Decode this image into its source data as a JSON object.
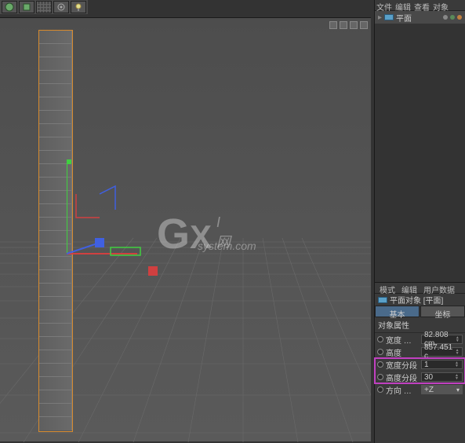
{
  "toolbar": {
    "icons": [
      "sphere-icon",
      "cube-icon",
      "grid-icon",
      "gear-icon",
      "light-icon"
    ]
  },
  "top_menu": {
    "items": [
      "文件",
      "编辑",
      "查看",
      "对象"
    ]
  },
  "hierarchy": {
    "item": {
      "label": "平面"
    }
  },
  "attr_menu": {
    "items": [
      "模式",
      "编辑",
      "用户数据"
    ]
  },
  "attributes": {
    "title": "平面对象 [平面]",
    "tabs": {
      "basic": "基本",
      "coord": "坐标"
    },
    "section": "对象属性",
    "rows": {
      "width": {
        "label": "宽度 …",
        "value": "82.808 cm"
      },
      "height": {
        "label": "高度",
        "value": "857.451 c"
      },
      "wseg": {
        "label": "宽度分段",
        "value": "1"
      },
      "hseg": {
        "label": "高度分段",
        "value": "30"
      },
      "dir": {
        "label": "方向 …",
        "value": "+Z"
      }
    }
  },
  "watermark": {
    "g": "G",
    "x": "X",
    "cn": "I 网",
    "sub": "system.com"
  }
}
